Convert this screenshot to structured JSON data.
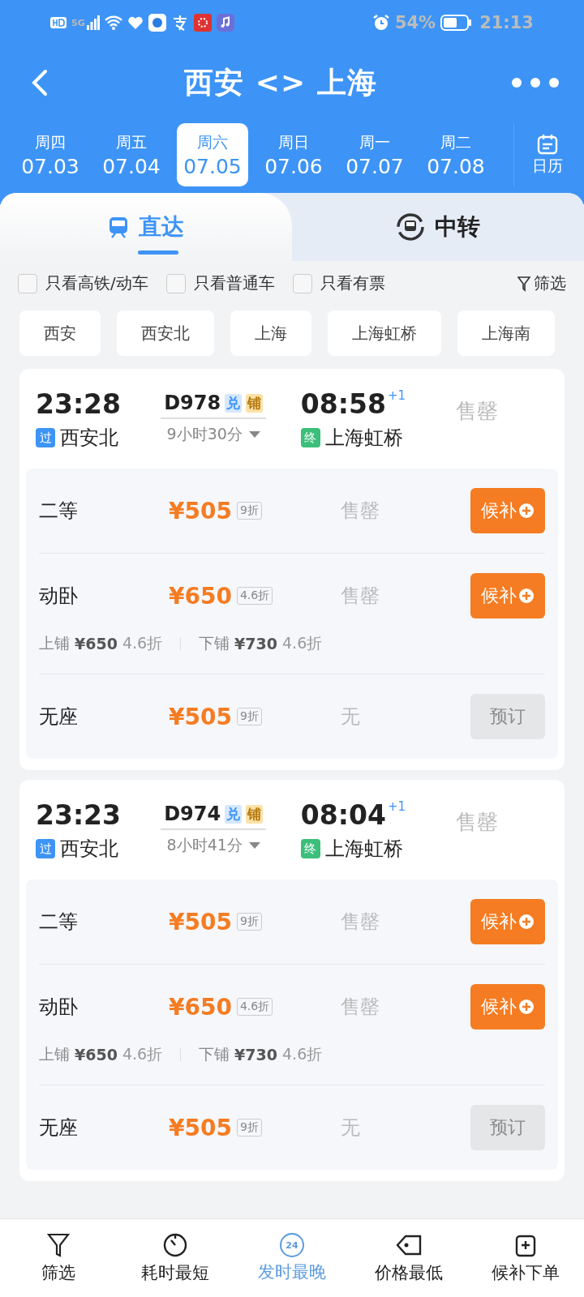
{
  "status_bar": {
    "network": "5G",
    "battery": "54%",
    "time": "21:13"
  },
  "header": {
    "title": "西安 <> 上海"
  },
  "dates": [
    {
      "weekday": "周四",
      "date": "07.03",
      "selected": false
    },
    {
      "weekday": "周五",
      "date": "07.04",
      "selected": false
    },
    {
      "weekday": "周六",
      "date": "07.05",
      "selected": true
    },
    {
      "weekday": "周日",
      "date": "07.06",
      "selected": false
    },
    {
      "weekday": "周一",
      "date": "07.07",
      "selected": false
    },
    {
      "weekday": "周二",
      "date": "07.08",
      "selected": false
    }
  ],
  "calendar_button": "日历",
  "tabs": [
    {
      "label": "直达",
      "kind": "direct",
      "selected": true
    },
    {
      "label": "中转",
      "kind": "transfer",
      "selected": false
    }
  ],
  "filters": [
    {
      "label": "只看高铁/动车",
      "checked": false
    },
    {
      "label": "只看普通车",
      "checked": false
    },
    {
      "label": "只看有票",
      "checked": false
    }
  ],
  "filter_button": "筛选",
  "stations": [
    "西安",
    "西安北",
    "上海",
    "上海虹桥",
    "上海南"
  ],
  "trains": [
    {
      "depart_time": "23:28",
      "train_no": "D978",
      "tags": [
        {
          "label": "兑",
          "kind": "blue"
        },
        {
          "label": "铺",
          "kind": "gold"
        }
      ],
      "arrive_time": "08:58",
      "day_offset": "+1",
      "status": "售罄",
      "from_tag": "过",
      "from_station": "西安北",
      "duration": "9小时30分",
      "to_tag": "终",
      "to_station": "上海虹桥",
      "seats": [
        {
          "name": "二等",
          "price": "¥505",
          "discount": "9折",
          "availability": "售罄",
          "action": "候补",
          "kind": "waitlist"
        },
        {
          "name": "动卧",
          "price": "¥650",
          "discount": "4.6折",
          "availability": "售罄",
          "action": "候补",
          "kind": "waitlist",
          "berths": [
            {
              "label": "上铺",
              "price": "¥650",
              "discount": "4.6折"
            },
            {
              "label": "下铺",
              "price": "¥730",
              "discount": "4.6折"
            }
          ]
        },
        {
          "name": "无座",
          "price": "¥505",
          "discount": "9折",
          "availability": "无",
          "action": "预订",
          "kind": "book",
          "disabled": true
        }
      ]
    },
    {
      "depart_time": "23:23",
      "train_no": "D974",
      "tags": [
        {
          "label": "兑",
          "kind": "blue"
        },
        {
          "label": "铺",
          "kind": "gold"
        }
      ],
      "arrive_time": "08:04",
      "day_offset": "+1",
      "status": "售罄",
      "from_tag": "过",
      "from_station": "西安北",
      "duration": "8小时41分",
      "to_tag": "终",
      "to_station": "上海虹桥",
      "seats": [
        {
          "name": "二等",
          "price": "¥505",
          "discount": "9折",
          "availability": "售罄",
          "action": "候补",
          "kind": "waitlist"
        },
        {
          "name": "动卧",
          "price": "¥650",
          "discount": "4.6折",
          "availability": "售罄",
          "action": "候补",
          "kind": "waitlist",
          "berths": [
            {
              "label": "上铺",
              "price": "¥650",
              "discount": "4.6折"
            },
            {
              "label": "下铺",
              "price": "¥730",
              "discount": "4.6折"
            }
          ]
        },
        {
          "name": "无座",
          "price": "¥505",
          "discount": "9折",
          "availability": "无",
          "action": "预订",
          "kind": "book",
          "disabled": true
        }
      ]
    }
  ],
  "bottom_nav": [
    {
      "label": "筛选",
      "kind": "filter",
      "selected": false
    },
    {
      "label": "耗时最短",
      "kind": "clock",
      "selected": false
    },
    {
      "label": "发时最晚",
      "kind": "latest",
      "icon_text": "24",
      "selected": true
    },
    {
      "label": "价格最低",
      "kind": "tag",
      "selected": false
    },
    {
      "label": "候补下单",
      "kind": "order",
      "selected": false
    }
  ]
}
